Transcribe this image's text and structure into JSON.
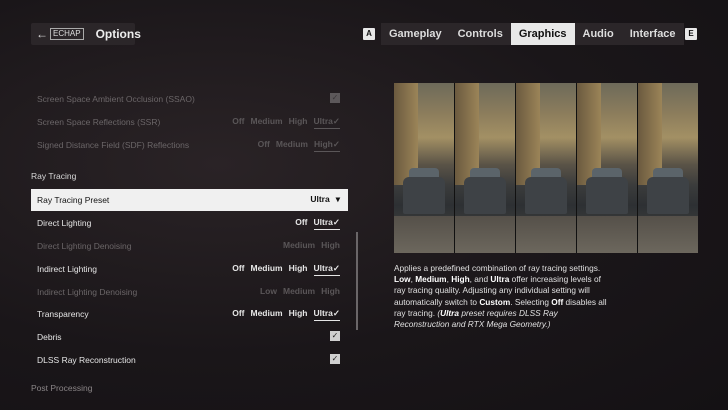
{
  "header": {
    "back_arrow": "←",
    "esc_label": "ECHAP",
    "title": "Options",
    "prev_key": "A",
    "next_key": "E",
    "tabs": [
      {
        "label": "Gameplay"
      },
      {
        "label": "Controls"
      },
      {
        "label": "Graphics"
      },
      {
        "label": "Audio"
      },
      {
        "label": "Interface"
      }
    ]
  },
  "settings": {
    "upper": {
      "ssao": {
        "label": "Screen Space Ambient Occlusion (SSAO)"
      },
      "ssr": {
        "label": "Screen Space Reflections (SSR)",
        "options": [
          "Off",
          "Medium",
          "High",
          "Ultra"
        ],
        "selected": "Ultra"
      },
      "sdf": {
        "label": "Signed Distance Field (SDF) Reflections",
        "options": [
          "Off",
          "Medium",
          "High"
        ],
        "selected": "High"
      }
    },
    "ray_tracing_section": "Ray Tracing",
    "rt": {
      "preset": {
        "label": "Ray Tracing Preset",
        "value": "Ultra",
        "caret": "▾"
      },
      "direct": {
        "label": "Direct Lighting",
        "options": [
          "Off",
          "Ultra"
        ],
        "selected": "Ultra"
      },
      "direct_denoise": {
        "label": "Direct Lighting Denoising",
        "options": [
          "Medium",
          "High"
        ],
        "selected": "High"
      },
      "indirect": {
        "label": "Indirect Lighting",
        "options": [
          "Off",
          "Medium",
          "High",
          "Ultra"
        ],
        "selected": "Ultra"
      },
      "indirect_denoise": {
        "label": "Indirect Lighting Denoising",
        "options": [
          "Low",
          "Medium",
          "High"
        ],
        "selected": "High"
      },
      "transparency": {
        "label": "Transparency",
        "options": [
          "Off",
          "Medium",
          "High",
          "Ultra"
        ],
        "selected": "Ultra"
      },
      "debris": {
        "label": "Debris",
        "checked": true
      },
      "dlss": {
        "label": "DLSS Ray Reconstruction",
        "checked": true
      }
    },
    "post_section": "Post Processing",
    "check": "✓"
  },
  "description": {
    "p1": "Applies a predefined combination of ray tracing settings. ",
    "low": "Low",
    "c1": ", ",
    "medium": "Medium",
    "c2": ", ",
    "high": "High",
    "c3": ", and ",
    "ultra": "Ultra",
    "p2": " offer increasing levels of ray tracing quality. Adjusting any individual setting will automatically switch to ",
    "custom": "Custom",
    "p3": ". Selecting ",
    "off": "Off",
    "p4": " disables all ray tracing. ",
    "note_open": "(",
    "note_ultra": "Ultra",
    "note_rest": " preset requires DLSS Ray Reconstruction and RTX Mega Geometry.)"
  },
  "colors": {
    "accent": "#f0f0f0",
    "bg": "#1a1619",
    "dim": "#6b6668"
  }
}
